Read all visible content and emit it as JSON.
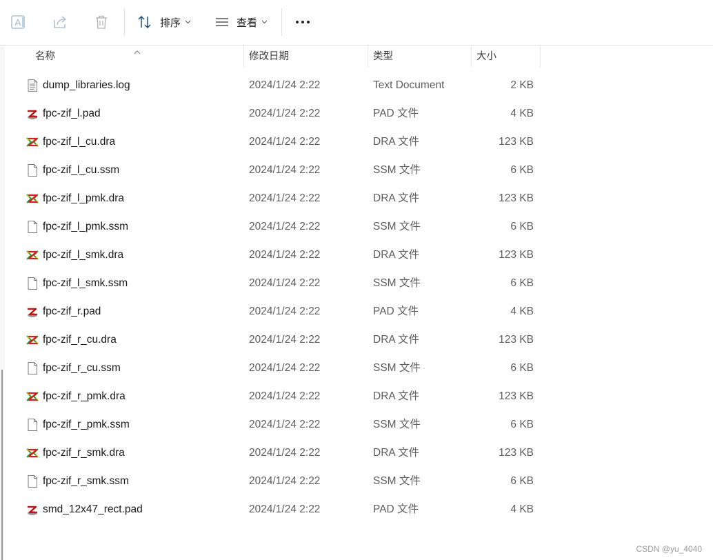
{
  "toolbar": {
    "sort_label": "排序",
    "view_label": "查看"
  },
  "columns": {
    "name": "名称",
    "date": "修改日期",
    "type": "类型",
    "size": "大小"
  },
  "files": [
    {
      "name": "dump_libraries.log",
      "date": "2024/1/24 2:22",
      "type": "Text Document",
      "size": "2 KB",
      "icon": "log-file-icon"
    },
    {
      "name": "fpc-zif_l.pad",
      "date": "2024/1/24 2:22",
      "type": "PAD 文件",
      "size": "4 KB",
      "icon": "pad-file-icon"
    },
    {
      "name": "fpc-zif_l_cu.dra",
      "date": "2024/1/24 2:22",
      "type": "DRA 文件",
      "size": "123 KB",
      "icon": "dra-file-icon"
    },
    {
      "name": "fpc-zif_l_cu.ssm",
      "date": "2024/1/24 2:22",
      "type": "SSM 文件",
      "size": "6 KB",
      "icon": "blank-file-icon"
    },
    {
      "name": "fpc-zif_l_pmk.dra",
      "date": "2024/1/24 2:22",
      "type": "DRA 文件",
      "size": "123 KB",
      "icon": "dra-file-icon"
    },
    {
      "name": "fpc-zif_l_pmk.ssm",
      "date": "2024/1/24 2:22",
      "type": "SSM 文件",
      "size": "6 KB",
      "icon": "blank-file-icon"
    },
    {
      "name": "fpc-zif_l_smk.dra",
      "date": "2024/1/24 2:22",
      "type": "DRA 文件",
      "size": "123 KB",
      "icon": "dra-file-icon"
    },
    {
      "name": "fpc-zif_l_smk.ssm",
      "date": "2024/1/24 2:22",
      "type": "SSM 文件",
      "size": "6 KB",
      "icon": "blank-file-icon"
    },
    {
      "name": "fpc-zif_r.pad",
      "date": "2024/1/24 2:22",
      "type": "PAD 文件",
      "size": "4 KB",
      "icon": "pad-file-icon"
    },
    {
      "name": "fpc-zif_r_cu.dra",
      "date": "2024/1/24 2:22",
      "type": "DRA 文件",
      "size": "123 KB",
      "icon": "dra-file-icon"
    },
    {
      "name": "fpc-zif_r_cu.ssm",
      "date": "2024/1/24 2:22",
      "type": "SSM 文件",
      "size": "6 KB",
      "icon": "blank-file-icon"
    },
    {
      "name": "fpc-zif_r_pmk.dra",
      "date": "2024/1/24 2:22",
      "type": "DRA 文件",
      "size": "123 KB",
      "icon": "dra-file-icon"
    },
    {
      "name": "fpc-zif_r_pmk.ssm",
      "date": "2024/1/24 2:22",
      "type": "SSM 文件",
      "size": "6 KB",
      "icon": "blank-file-icon"
    },
    {
      "name": "fpc-zif_r_smk.dra",
      "date": "2024/1/24 2:22",
      "type": "DRA 文件",
      "size": "123 KB",
      "icon": "dra-file-icon"
    },
    {
      "name": "fpc-zif_r_smk.ssm",
      "date": "2024/1/24 2:22",
      "type": "SSM 文件",
      "size": "6 KB",
      "icon": "blank-file-icon"
    },
    {
      "name": "smd_12x47_rect.pad",
      "date": "2024/1/24 2:22",
      "type": "PAD 文件",
      "size": "4 KB",
      "icon": "pad-file-icon"
    }
  ],
  "watermark": "CSDN @yu_4040"
}
